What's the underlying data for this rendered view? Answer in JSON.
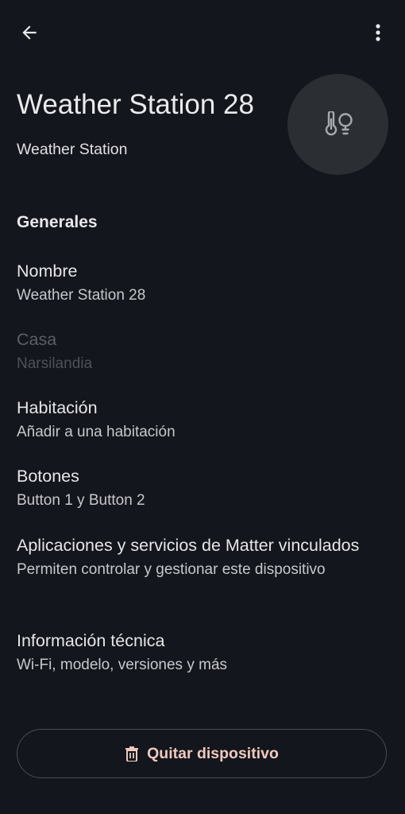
{
  "top_bar": {
    "back_icon": "arrow-left-icon",
    "menu_icon": "more-vertical-icon"
  },
  "header": {
    "title": "Weather Station 28",
    "subtitle": "Weather Station",
    "device_icon": "thermometer-bulb-icon"
  },
  "section": {
    "heading": "Generales"
  },
  "items": [
    {
      "label": "Nombre",
      "value": "Weather Station 28",
      "enabled": true
    },
    {
      "label": "Casa",
      "value": "Narsilandia",
      "enabled": false
    },
    {
      "label": "Habitación",
      "value": "Añadir a una habitación",
      "enabled": true
    },
    {
      "label": "Botones",
      "value": "Button 1 y Button 2",
      "enabled": true
    },
    {
      "label": "Aplicaciones y servicios de Matter vinculados",
      "value": "Permiten controlar y gestionar este dispositivo",
      "enabled": true
    },
    {
      "label": "Información técnica",
      "value": "Wi-Fi, modelo, versiones y más",
      "enabled": true
    }
  ],
  "remove_button": {
    "label": "Quitar dispositivo",
    "icon": "trash-icon"
  },
  "colors": {
    "background": "#13161c",
    "accent_text": "#f0c9be",
    "icon_circle": "#2b2e33"
  }
}
